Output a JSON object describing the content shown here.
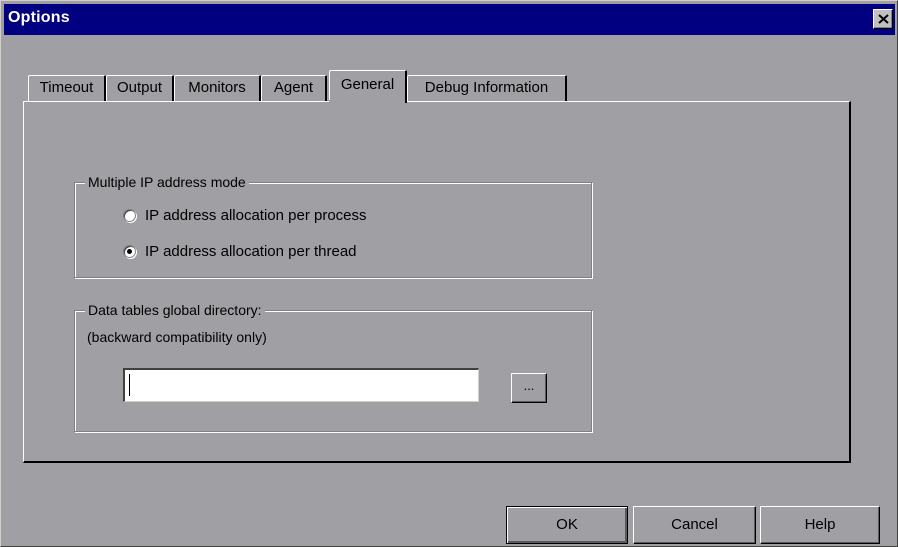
{
  "window": {
    "title": "Options"
  },
  "tabs": [
    {
      "label": "Timeout",
      "active": false
    },
    {
      "label": "Output",
      "active": false
    },
    {
      "label": "Monitors",
      "active": false
    },
    {
      "label": "Agent",
      "active": false
    },
    {
      "label": "General",
      "active": true
    },
    {
      "label": "Debug Information",
      "active": false
    }
  ],
  "ip_group": {
    "label": "Multiple IP address mode",
    "options": [
      {
        "label": "IP address allocation per process",
        "selected": false
      },
      {
        "label": "IP address allocation per thread",
        "selected": true
      }
    ]
  },
  "data_group": {
    "label": "Data tables global directory:",
    "sublabel": "(backward compatibility only)",
    "input_value": "",
    "browse_label": "..."
  },
  "buttons": {
    "ok": "OK",
    "cancel": "Cancel",
    "help": "Help"
  },
  "icons": {
    "close": "close-icon"
  }
}
